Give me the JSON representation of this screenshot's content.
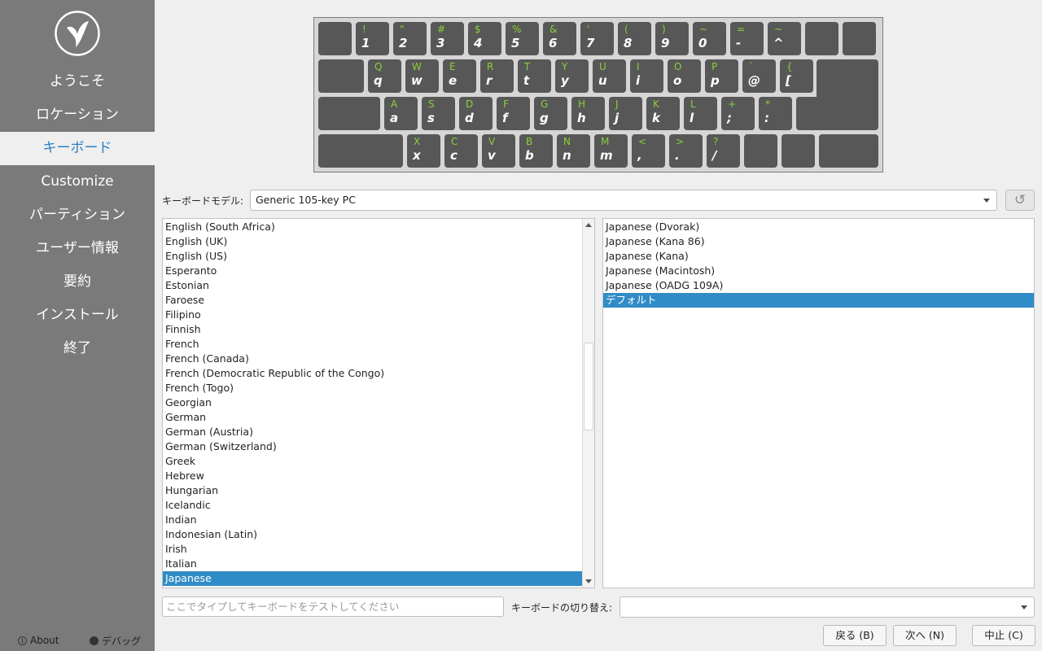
{
  "sidebar": {
    "steps": [
      {
        "label": "ようこそ",
        "active": false
      },
      {
        "label": "ロケーション",
        "active": false
      },
      {
        "label": "キーボード",
        "active": true
      },
      {
        "label": "Customize",
        "active": false
      },
      {
        "label": "パーティション",
        "active": false
      },
      {
        "label": "ユーザー情報",
        "active": false
      },
      {
        "label": "要約",
        "active": false
      },
      {
        "label": "インストール",
        "active": false
      },
      {
        "label": "終了",
        "active": false
      }
    ],
    "about_label": "About",
    "debug_label": "デバッグ"
  },
  "keyboard": {
    "rows": [
      [
        {
          "w": "n",
          "up": "",
          "lo": ""
        },
        {
          "w": "n",
          "up": "!",
          "lo": "1"
        },
        {
          "w": "n",
          "up": "\"",
          "lo": "2"
        },
        {
          "w": "n",
          "up": "#",
          "lo": "3"
        },
        {
          "w": "n",
          "up": "$",
          "lo": "4"
        },
        {
          "w": "n",
          "up": "%",
          "lo": "5"
        },
        {
          "w": "n",
          "up": "&",
          "lo": "6"
        },
        {
          "w": "n",
          "up": "'",
          "lo": "7"
        },
        {
          "w": "n",
          "up": "(",
          "lo": "8"
        },
        {
          "w": "n",
          "up": ")",
          "lo": "9"
        },
        {
          "w": "n",
          "up": "~",
          "lo": "0"
        },
        {
          "w": "n",
          "up": "=",
          "lo": "-"
        },
        {
          "w": "n",
          "up": "~",
          "lo": "^"
        },
        {
          "w": "n",
          "up": "",
          "lo": ""
        },
        {
          "w": "n",
          "up": "",
          "lo": ""
        }
      ],
      [
        {
          "w": "tab",
          "up": "",
          "lo": ""
        },
        {
          "w": "n",
          "up": "Q",
          "lo": "q"
        },
        {
          "w": "n",
          "up": "W",
          "lo": "w"
        },
        {
          "w": "n",
          "up": "E",
          "lo": "e"
        },
        {
          "w": "n",
          "up": "R",
          "lo": "r"
        },
        {
          "w": "n",
          "up": "T",
          "lo": "t"
        },
        {
          "w": "n",
          "up": "Y",
          "lo": "y"
        },
        {
          "w": "n",
          "up": "U",
          "lo": "u"
        },
        {
          "w": "n",
          "up": "I",
          "lo": "i"
        },
        {
          "w": "n",
          "up": "O",
          "lo": "o"
        },
        {
          "w": "n",
          "up": "P",
          "lo": "p"
        },
        {
          "w": "n",
          "up": "`",
          "lo": "@"
        },
        {
          "w": "n",
          "up": "{",
          "lo": "["
        }
      ],
      [
        {
          "w": "caps",
          "up": "",
          "lo": ""
        },
        {
          "w": "n",
          "up": "A",
          "lo": "a"
        },
        {
          "w": "n",
          "up": "S",
          "lo": "s"
        },
        {
          "w": "n",
          "up": "D",
          "lo": "d"
        },
        {
          "w": "n",
          "up": "F",
          "lo": "f"
        },
        {
          "w": "n",
          "up": "G",
          "lo": "g"
        },
        {
          "w": "n",
          "up": "H",
          "lo": "h"
        },
        {
          "w": "n",
          "up": "J",
          "lo": "j"
        },
        {
          "w": "n",
          "up": "K",
          "lo": "k"
        },
        {
          "w": "n",
          "up": "L",
          "lo": "l"
        },
        {
          "w": "n",
          "up": "+",
          "lo": ";"
        },
        {
          "w": "n",
          "up": "*",
          "lo": ":"
        },
        {
          "w": "n",
          "up": "",
          "lo": ""
        }
      ],
      [
        {
          "w": "shift",
          "up": "",
          "lo": ""
        },
        {
          "w": "n",
          "up": "X",
          "lo": "x"
        },
        {
          "w": "n",
          "up": "C",
          "lo": "c"
        },
        {
          "w": "n",
          "up": "V",
          "lo": "v"
        },
        {
          "w": "n",
          "up": "B",
          "lo": "b"
        },
        {
          "w": "n",
          "up": "N",
          "lo": "n"
        },
        {
          "w": "n",
          "up": "M",
          "lo": "m"
        },
        {
          "w": "n",
          "up": "<",
          "lo": ","
        },
        {
          "w": "n",
          "up": ">",
          "lo": "."
        },
        {
          "w": "n",
          "up": "?",
          "lo": "/"
        },
        {
          "w": "n",
          "up": "",
          "lo": ""
        },
        {
          "w": "n",
          "up": "",
          "lo": ""
        },
        {
          "w": "rshift",
          "up": "",
          "lo": ""
        }
      ]
    ]
  },
  "model": {
    "label": "キーボードモデル:",
    "value": "Generic 105-key PC",
    "reset_icon": "↺"
  },
  "layouts": [
    "English (South Africa)",
    "English (UK)",
    "English (US)",
    "Esperanto",
    "Estonian",
    "Faroese",
    "Filipino",
    "Finnish",
    "French",
    "French (Canada)",
    "French (Democratic Republic of the Congo)",
    "French (Togo)",
    "Georgian",
    "German",
    "German (Austria)",
    "German (Switzerland)",
    "Greek",
    "Hebrew",
    "Hungarian",
    "Icelandic",
    "Indian",
    "Indonesian (Latin)",
    "Irish",
    "Italian",
    "Japanese"
  ],
  "selected_layout": "Japanese",
  "variants": [
    "Japanese (Dvorak)",
    "Japanese (Kana 86)",
    "Japanese (Kana)",
    "Japanese (Macintosh)",
    "Japanese (OADG 109A)",
    "デフォルト"
  ],
  "selected_variant": "デフォルト",
  "test": {
    "placeholder": "ここでタイプしてキーボードをテストしてください",
    "value": ""
  },
  "switch": {
    "label": "キーボードの切り替え:",
    "value": ""
  },
  "buttons": {
    "back": "戻る (B)",
    "next": "次へ (N)",
    "cancel": "中止 (C)"
  }
}
